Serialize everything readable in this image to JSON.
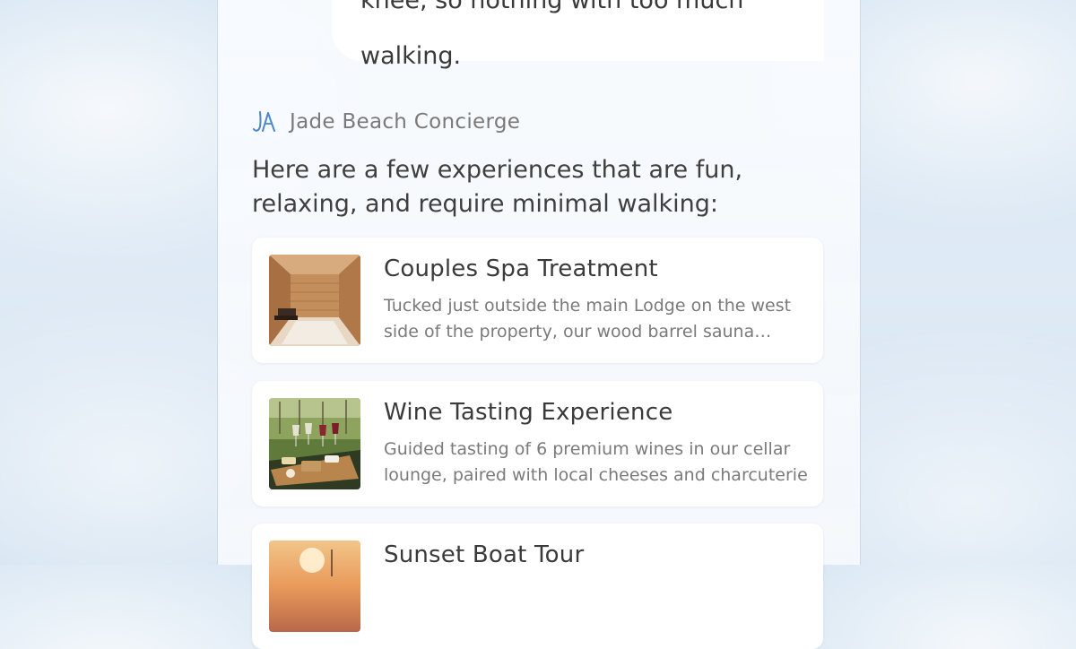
{
  "colors": {
    "page_background": "#dbe8f4",
    "panel_background": "#f7fafd",
    "bubble_background": "#ffffff",
    "text_primary": "#3a3a3a",
    "text_secondary": "#7a7a7a",
    "logo_accent": "#4a86c8"
  },
  "user_message": {
    "line_partial": "knee, so nothing with too much",
    "line_last": "walking."
  },
  "assistant": {
    "logo_icon": "jade-beach-monogram-icon",
    "sender_name": "Jade Beach Concierge",
    "intro_text": "Here are a few experiences that are fun, relaxing, and require minimal walking:"
  },
  "experiences": [
    {
      "title": "Couples Spa Treatment",
      "description": "Tucked just outside the main Lodge on the west side of the property, our wood barrel sauna accommodates guests",
      "image_icon": "sauna-photo"
    },
    {
      "title": "Wine Tasting Experience",
      "description": "Guided tasting of 6 premium wines in our cellar lounge, paired with local cheeses and charcuterie",
      "image_icon": "wine-tasting-photo"
    },
    {
      "title": "Sunset Boat Tour",
      "description": "",
      "image_icon": "sunset-photo"
    }
  ]
}
